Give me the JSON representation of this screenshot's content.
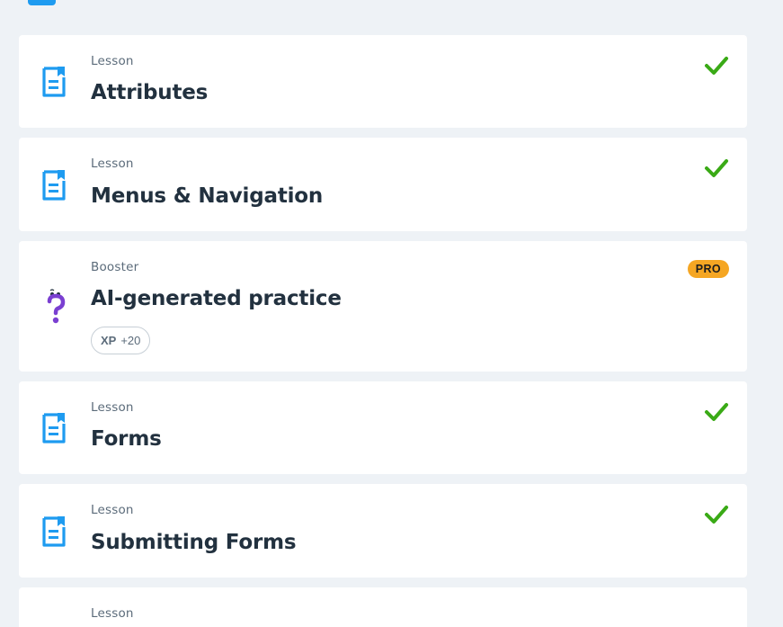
{
  "header": {
    "icon": "folder-icon"
  },
  "items": [
    {
      "type": "Lesson",
      "title": "Attributes",
      "icon": "lesson-document-icon",
      "status": "completed"
    },
    {
      "type": "Lesson",
      "title": "Menus & Navigation",
      "icon": "lesson-document-icon",
      "status": "completed"
    },
    {
      "type": "Booster",
      "title": "AI-generated practice",
      "icon": "question-mascot-icon",
      "badge": "PRO",
      "xp_label": "XP",
      "xp_points": "+20"
    },
    {
      "type": "Lesson",
      "title": "Forms",
      "icon": "lesson-document-icon",
      "status": "completed"
    },
    {
      "type": "Lesson",
      "title": "Submitting Forms",
      "icon": "lesson-document-icon",
      "status": "completed"
    },
    {
      "type": "Lesson"
    }
  ],
  "colors": {
    "background": "#eef2f6",
    "card": "#ffffff",
    "accent_blue": "#1e9bf0",
    "check_green": "#3aaa16",
    "pro_badge": "#f5a623",
    "mascot_purple": "#7a3fd1"
  }
}
